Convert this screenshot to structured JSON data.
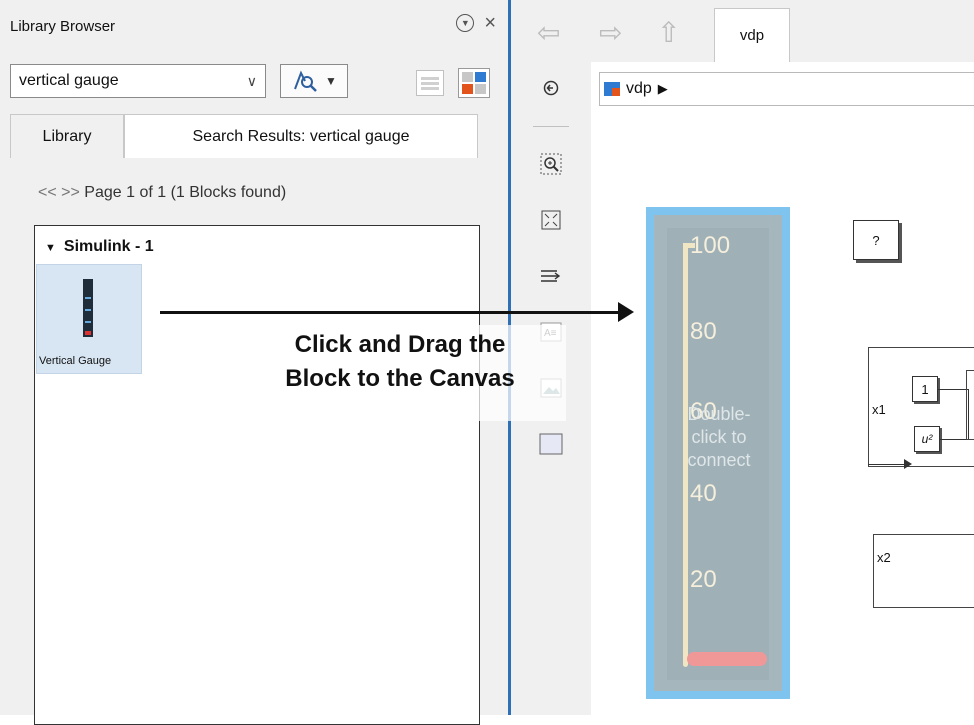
{
  "library_browser": {
    "title": "Library Browser",
    "search_value": "vertical gauge",
    "tabs": [
      "Library",
      "Search Results: vertical gauge"
    ],
    "pager_arrows": "<< >>",
    "pager_text": "Page 1 of 1 (1 Blocks found)",
    "group_label": "Simulink - 1",
    "block_label": "Vertical Gauge"
  },
  "editor": {
    "tab_label": "vdp",
    "address": "vdp",
    "address_chevron": "▶",
    "gauge": {
      "ticks": [
        "100",
        "80",
        "60",
        "40",
        "20"
      ],
      "overlay_lines": [
        "Double-",
        "click to",
        "connect"
      ],
      "level_percent": 0
    },
    "unknown_block": "?",
    "x1_label": "x1",
    "x2_label": "x2",
    "constant_value": "1",
    "square_label": "u²"
  },
  "annotation": {
    "line1": "Click and Drag the",
    "line2": "Block to the Canvas"
  },
  "colors": {
    "divider": "#2f6fb5",
    "gauge_frame": "#7ec4ee",
    "gauge_body": "#a6b6bd",
    "gauge_fill": "#f09898",
    "tile_selected": "#d8e6f4"
  }
}
